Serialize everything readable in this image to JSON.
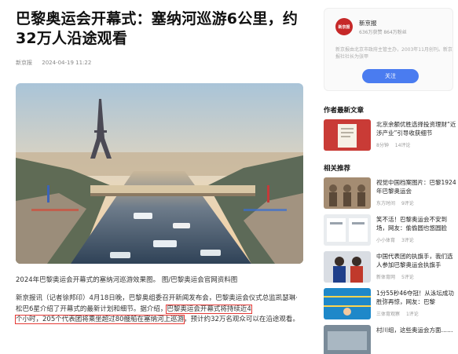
{
  "article": {
    "title": "巴黎奥运会开幕式：塞纳河巡游6公里，约32万人沿途观看",
    "source": "新京报",
    "date": "2024-04-19 11:22",
    "caption": "2024年巴黎奥运会开幕式的塞纳河巡游效果图。 图/巴黎奥运会官网资料图",
    "para_before": "新京报讯（记者徐邦印）4月18日晚，巴黎奥组委召开新闻发布会，巴黎奥运会仪式总监凯瑟琳·松巴6星介绍了开幕式的最新计划和细节。据介绍，",
    "highlight_1": "巴黎奥运会开幕式将持续近4",
    "highlight_2a": "个小时，",
    "highlight_2b": "205个代表团将乘坐超过80艘船在塞纳河上巡游",
    "para_after": "，预计约32万名观众可以在沿途观看。"
  },
  "sidebar": {
    "account": {
      "avatar_text": "新京报",
      "name": "新京报",
      "stats": "636万获赞 864万粉丝",
      "desc": "新京报由北京市政府主管主办，2003年11月创刊。新京报社社长为张甲",
      "follow_label": "关注"
    },
    "latest_title": "作者最新文章",
    "latest": [
      {
        "title": "北京余额优胜选择投资理财“近涉产业”引导收获细节",
        "time": "8分钟",
        "comments": "14评论"
      }
    ],
    "related_title": "相关推荐",
    "related": [
      {
        "title": "视觉中国档案图片：巴黎1924年巴黎奥运会",
        "source": "东方时间",
        "comments": "9评论"
      },
      {
        "title": "笑不活！巴黎奥运会不安到场，网友：偷偷圆也悠圆脸",
        "source": "小小体育",
        "comments": "3评论"
      },
      {
        "title": "中国代表团的执旗手，我们选人参加巴黎奥运会执旗手",
        "source": "新体育网",
        "comments": "5评论"
      },
      {
        "title": "1分55秒46夺冠！从泳坛成功胜弥再惊，网友：巴黎",
        "source": "三体育观察",
        "comments": "1评论"
      },
      {
        "title": "村川组，这些奥运会方面……",
        "source": "",
        "comments": ""
      }
    ]
  },
  "colors": {
    "highlight_border": "#e53935",
    "follow_button": "#4a7cf0",
    "avatar_bg": "#c62828"
  },
  "icons": [
    "newspaper-logo-icon"
  ]
}
